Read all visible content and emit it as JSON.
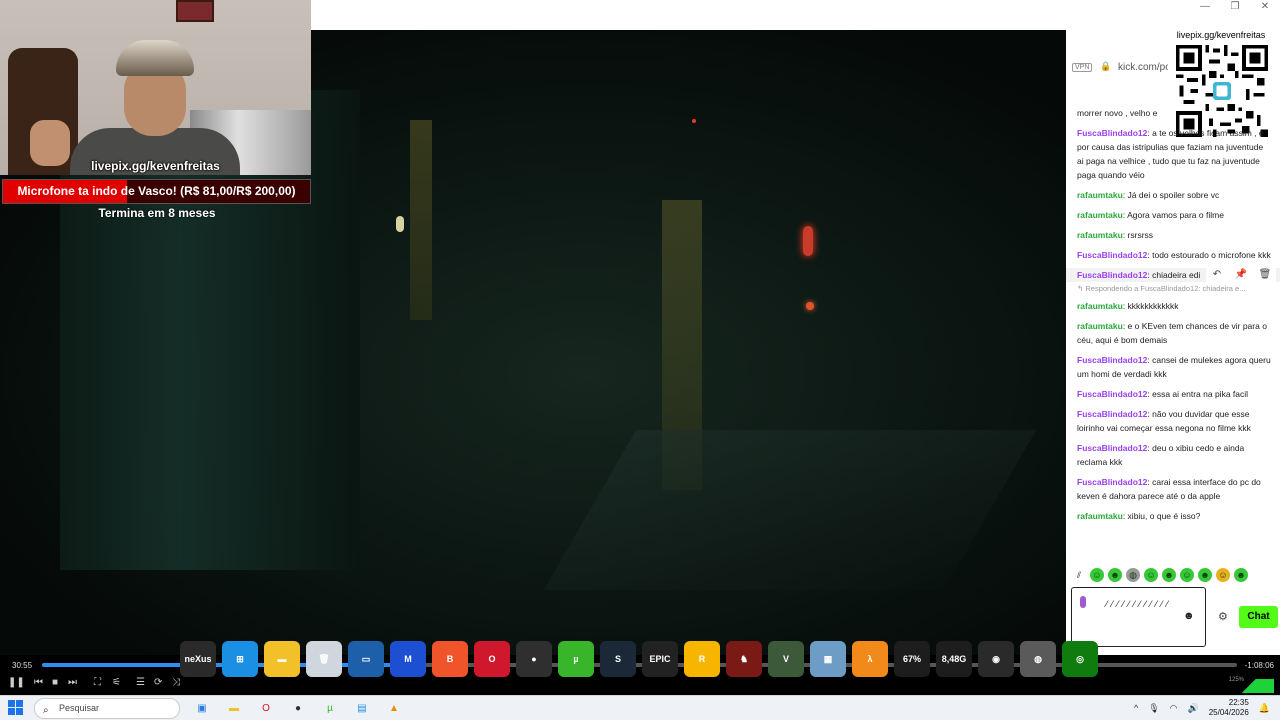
{
  "window": {
    "min": "—",
    "max": "❐",
    "close": "✕"
  },
  "overlay": {
    "url": "livepix.gg/kevenfreitas",
    "goal_text": "Microfone ta indo de Vasco! (R$ 81,00/R$ 200,00)",
    "goal_fraction": 0.405,
    "ends": "Termina em 8 meses",
    "qr_label": "livepix.gg/kevenfreitas"
  },
  "browser": {
    "vpn": "VPN",
    "lock": "🔒",
    "url": "kick.com/po"
  },
  "chat": {
    "messages": [
      {
        "user": "",
        "color": "",
        "text": "morrer novo , velho e"
      },
      {
        "user": "FuscaBlindado12",
        "color": "purple",
        "text": ": a te os velhos ficam assim , é por causa das istripulias que faziam na juventude ai paga na velhice , tudo que tu faz na juventude paga quando véio"
      },
      {
        "user": "rafaumtaku",
        "color": "green",
        "text": ": Já dei o spoiler sobre vc"
      },
      {
        "user": "rafaumtaku",
        "color": "green",
        "text": ": Agora vamos para o filme"
      },
      {
        "user": "rafaumtaku",
        "color": "green",
        "text": ": rsrsrss"
      },
      {
        "user": "FuscaBlindado12",
        "color": "purple",
        "text": ": todo estourado o microfone kkk"
      },
      {
        "user": "FuscaBlindado12",
        "color": "purple",
        "text": ": chiadeira edi"
      },
      {
        "user": "rafaumtaku",
        "color": "green",
        "text": ": kkkkkkkkkkkk"
      },
      {
        "user": "rafaumtaku",
        "color": "green",
        "text": ": e o KEven tem chances de vir para o céu, aqui é bom demais"
      },
      {
        "user": "FuscaBlindado12",
        "color": "purple",
        "text": ": cansei de mulekes agora queru um homi de verdadi kkk"
      },
      {
        "user": "FuscaBlindado12",
        "color": "purple",
        "text": ": essa ai entra na pika facil"
      },
      {
        "user": "FuscaBlindado12",
        "color": "purple",
        "text": ": não vou duvidar que esse loirinho vai começar essa negona no filme kkk"
      },
      {
        "user": "FuscaBlindado12",
        "color": "purple",
        "text": ": deu o xibiu cedo e ainda reclama kkk"
      },
      {
        "user": "FuscaBlindado12",
        "color": "purple",
        "text": ": carai essa interface do pc do keven é dahora parece até o da apple"
      },
      {
        "user": "rafaumtaku",
        "color": "green",
        "text": ": xibiu, o que é isso?"
      }
    ],
    "reply_hint": "↰ Respondendo a FuscaBlindado12: chiadeira e...",
    "actions": {
      "reply": "↶",
      "pin": "📌",
      "delete": "🗑"
    },
    "input_dots": "⁄⁄⁄⁄⁄⁄⁄⁄⁄⁄⁄⁄",
    "send_label": "Chat",
    "emoji_icon": "☻",
    "settings_icon": "⚙"
  },
  "player": {
    "time_elapsed": "30:55",
    "time_remaining": "-1:08:06",
    "progress_fraction": 0.31,
    "volume_label": "125%",
    "volume_fraction": 1.0
  },
  "dock": {
    "apps": [
      {
        "name": "nexus",
        "label": "neXus",
        "bg": "#2a2a2a"
      },
      {
        "name": "windows",
        "label": "⊞",
        "bg": "#1a8fe3"
      },
      {
        "name": "folder",
        "label": "▬",
        "bg": "#f2c028"
      },
      {
        "name": "recycle-bin",
        "label": "🗑",
        "bg": "#cfd6dd"
      },
      {
        "name": "monitor",
        "label": "▭",
        "bg": "#1d5fa8"
      },
      {
        "name": "malwarebytes",
        "label": "M",
        "bg": "#1c4fd1"
      },
      {
        "name": "brave",
        "label": "B",
        "bg": "#f0542a"
      },
      {
        "name": "opera",
        "label": "O",
        "bg": "#d0182c"
      },
      {
        "name": "obs",
        "label": "●",
        "bg": "#2f2f2f"
      },
      {
        "name": "utorrent",
        "label": "µ",
        "bg": "#38b52b"
      },
      {
        "name": "steam",
        "label": "S",
        "bg": "#1b2838"
      },
      {
        "name": "epic-games",
        "label": "EPIC",
        "bg": "#222"
      },
      {
        "name": "rockstar",
        "label": "R",
        "bg": "#f7b500"
      },
      {
        "name": "rdr2",
        "label": "♞",
        "bg": "#7a1a14"
      },
      {
        "name": "gta-v",
        "label": "V",
        "bg": "#3c5a3a"
      },
      {
        "name": "game-cover",
        "label": "▦",
        "bg": "#6d9cc7"
      },
      {
        "name": "half-life",
        "label": "λ",
        "bg": "#f18a1b"
      },
      {
        "name": "cpu-meter",
        "label": "67%",
        "bg": "#1d1d1d"
      },
      {
        "name": "memory-meter",
        "label": "8,48G",
        "bg": "#1d1d1d"
      },
      {
        "name": "camera",
        "label": "◉",
        "bg": "#2a2a2a"
      },
      {
        "name": "sphere",
        "label": "◍",
        "bg": "#5a5a5a"
      },
      {
        "name": "xbox",
        "label": "◎",
        "bg": "#107c10"
      }
    ]
  },
  "taskbar": {
    "search_placeholder": "Pesquisar",
    "apps": [
      {
        "name": "store",
        "label": "▣",
        "color": "#2a7be4"
      },
      {
        "name": "explorer",
        "label": "▬",
        "color": "#f2c028"
      },
      {
        "name": "opera-gx",
        "label": "O",
        "color": "#d0182c"
      },
      {
        "name": "obs-task",
        "label": "●",
        "color": "#333"
      },
      {
        "name": "utorrent-task",
        "label": "µ",
        "color": "#38b52b"
      },
      {
        "name": "notepad",
        "label": "▤",
        "color": "#1d8fe1"
      },
      {
        "name": "vlc",
        "label": "▲",
        "color": "#f08a00"
      }
    ],
    "tray_chevron": "^",
    "time": "22:35",
    "date": "25/04/2026"
  }
}
